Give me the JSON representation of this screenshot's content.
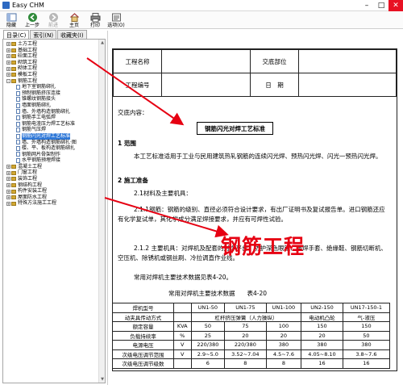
{
  "window": {
    "title": "Easy CHM",
    "minimize": "–",
    "maximize": "□",
    "close": "✕"
  },
  "toolbar": [
    {
      "label": "隐藏",
      "icon": "hide-icon",
      "enabled": true
    },
    {
      "label": "上一步",
      "icon": "back-icon",
      "enabled": true
    },
    {
      "label": "前进",
      "icon": "forward-icon",
      "enabled": false
    },
    {
      "label": "主页",
      "icon": "home-icon",
      "enabled": true
    },
    {
      "label": "打印",
      "icon": "print-icon",
      "enabled": true
    },
    {
      "label": "选项(O)",
      "icon": "options-icon",
      "enabled": true
    }
  ],
  "tabs": [
    "目录(C)",
    "索引(N)",
    "收藏夹(I)"
  ],
  "tree": [
    {
      "label": "土方工程",
      "level": 0,
      "type": "book",
      "expander": "+"
    },
    {
      "label": "基础工程",
      "level": 0,
      "type": "book",
      "expander": "+"
    },
    {
      "label": "砼面工程",
      "level": 0,
      "type": "book",
      "expander": "+"
    },
    {
      "label": "砌筑工程",
      "level": 0,
      "type": "book",
      "expander": "+"
    },
    {
      "label": "砌体工程",
      "level": 0,
      "type": "book",
      "expander": "+"
    },
    {
      "label": "模板工程",
      "level": 0,
      "type": "book",
      "expander": "+"
    },
    {
      "label": "钢筋工程",
      "level": 0,
      "type": "book",
      "expander": "-"
    },
    {
      "label": "地下室钢筋绑扎",
      "level": 1,
      "type": "page"
    },
    {
      "label": "预制钢筋挤压连接",
      "level": 1,
      "type": "page"
    },
    {
      "label": "锥螺纹钢筋接头",
      "level": 1,
      "type": "page"
    },
    {
      "label": "墙面钢筋绑扎",
      "level": 1,
      "type": "page"
    },
    {
      "label": "墙、外墙构造钢筋绑扎",
      "level": 1,
      "type": "page"
    },
    {
      "label": "钢筋手工电弧焊",
      "level": 1,
      "type": "page"
    },
    {
      "label": "钢筋电渣压力焊工艺标准",
      "level": 1,
      "type": "page"
    },
    {
      "label": "钢筋气压焊",
      "level": 1,
      "type": "page"
    },
    {
      "label": "钢筋闪光对焊工艺标准",
      "level": 1,
      "type": "page",
      "selected": true
    },
    {
      "label": "墙、外墙构造钢筋绑扎·图",
      "level": 1,
      "type": "page"
    },
    {
      "label": "楼、平、板构造钢筋绑扎",
      "level": 1,
      "type": "page"
    },
    {
      "label": "钢筋网片骨架制作",
      "level": 1,
      "type": "page"
    },
    {
      "label": "水平钢筋预埋焊接",
      "level": 1,
      "type": "page"
    },
    {
      "label": "混凝土工程",
      "level": 0,
      "type": "book",
      "expander": "+"
    },
    {
      "label": "门窗工程",
      "level": 0,
      "type": "book",
      "expander": "+"
    },
    {
      "label": "装饰工程",
      "level": 0,
      "type": "book",
      "expander": "+"
    },
    {
      "label": "钢结构工程",
      "level": 0,
      "type": "book",
      "expander": "+"
    },
    {
      "label": "构件安装工程",
      "level": 0,
      "type": "book",
      "expander": "+"
    },
    {
      "label": "屋面防水工程",
      "level": 0,
      "type": "book",
      "expander": "+"
    },
    {
      "label": "特殊方法施工工程",
      "level": 0,
      "type": "book",
      "expander": "+"
    }
  ],
  "doc": {
    "header": {
      "project_name_label": "工程名称",
      "notice_unit_label": "交底部位",
      "project_no_label": "工程编号",
      "date_label": "日　期"
    },
    "notice_label": "交底内容：",
    "standard_title": "钢筋闪光对焊工艺标准",
    "section1_heading": "1  范围",
    "section1_text": "本工艺标准适用于工业与民用建筑热轧钢筋的连续闪光焊、预热闪光焊、闪光一预热闪光焊。",
    "section2_heading": "2  施工准备",
    "s21": "2.1材料及主要机具：",
    "s211": "2.1.1钢筋：钢筋的级别、直径必须符合设计要求，有出厂证明书及复试报告单。进口钢筋还应有化学复试单，其化学成分满足焊接要求，并应有可焊性试验。",
    "s212": "2.1.2 主要机具：对焊机及配套的对焊平台、防护深色眼镜、电焊手套、绝缘鞋、钢筋切断机、空压机、除锈机或钢丝刷、冷拉调直作业线。",
    "table_intro": "常用对焊机主要技术数据见表4-20。",
    "overlay_text": "钢筋工程",
    "table_caption": "常用对焊机主要技术数据　　表4-20",
    "table": [
      [
        "焊机型号",
        "",
        "UN1-50",
        "UN1-75",
        "UN1-100",
        "UN2-150",
        "UN17-150-1"
      ],
      [
        "动夹具传动方式",
        "",
        "杠杆挤压弹簧（人力操纵）",
        "",
        "",
        "电动机凸轮",
        "气-液压"
      ],
      [
        "额定容量",
        "KVA",
        "50",
        "75",
        "100",
        "150",
        "150"
      ],
      [
        "负载持续率",
        "%",
        "25",
        "20",
        "20",
        "20",
        "50"
      ],
      [
        "电源电压",
        "V",
        "220/380",
        "220/380",
        "380",
        "380",
        "380"
      ],
      [
        "次级电压调节范围",
        "V",
        "2.9~5.0",
        "3.52~7.04",
        "4.5~7.6",
        "4.05~8.10",
        "3.8~7.6"
      ],
      [
        "次级电压调节级数",
        "",
        "6",
        "8",
        "8",
        "16",
        "16"
      ]
    ]
  }
}
